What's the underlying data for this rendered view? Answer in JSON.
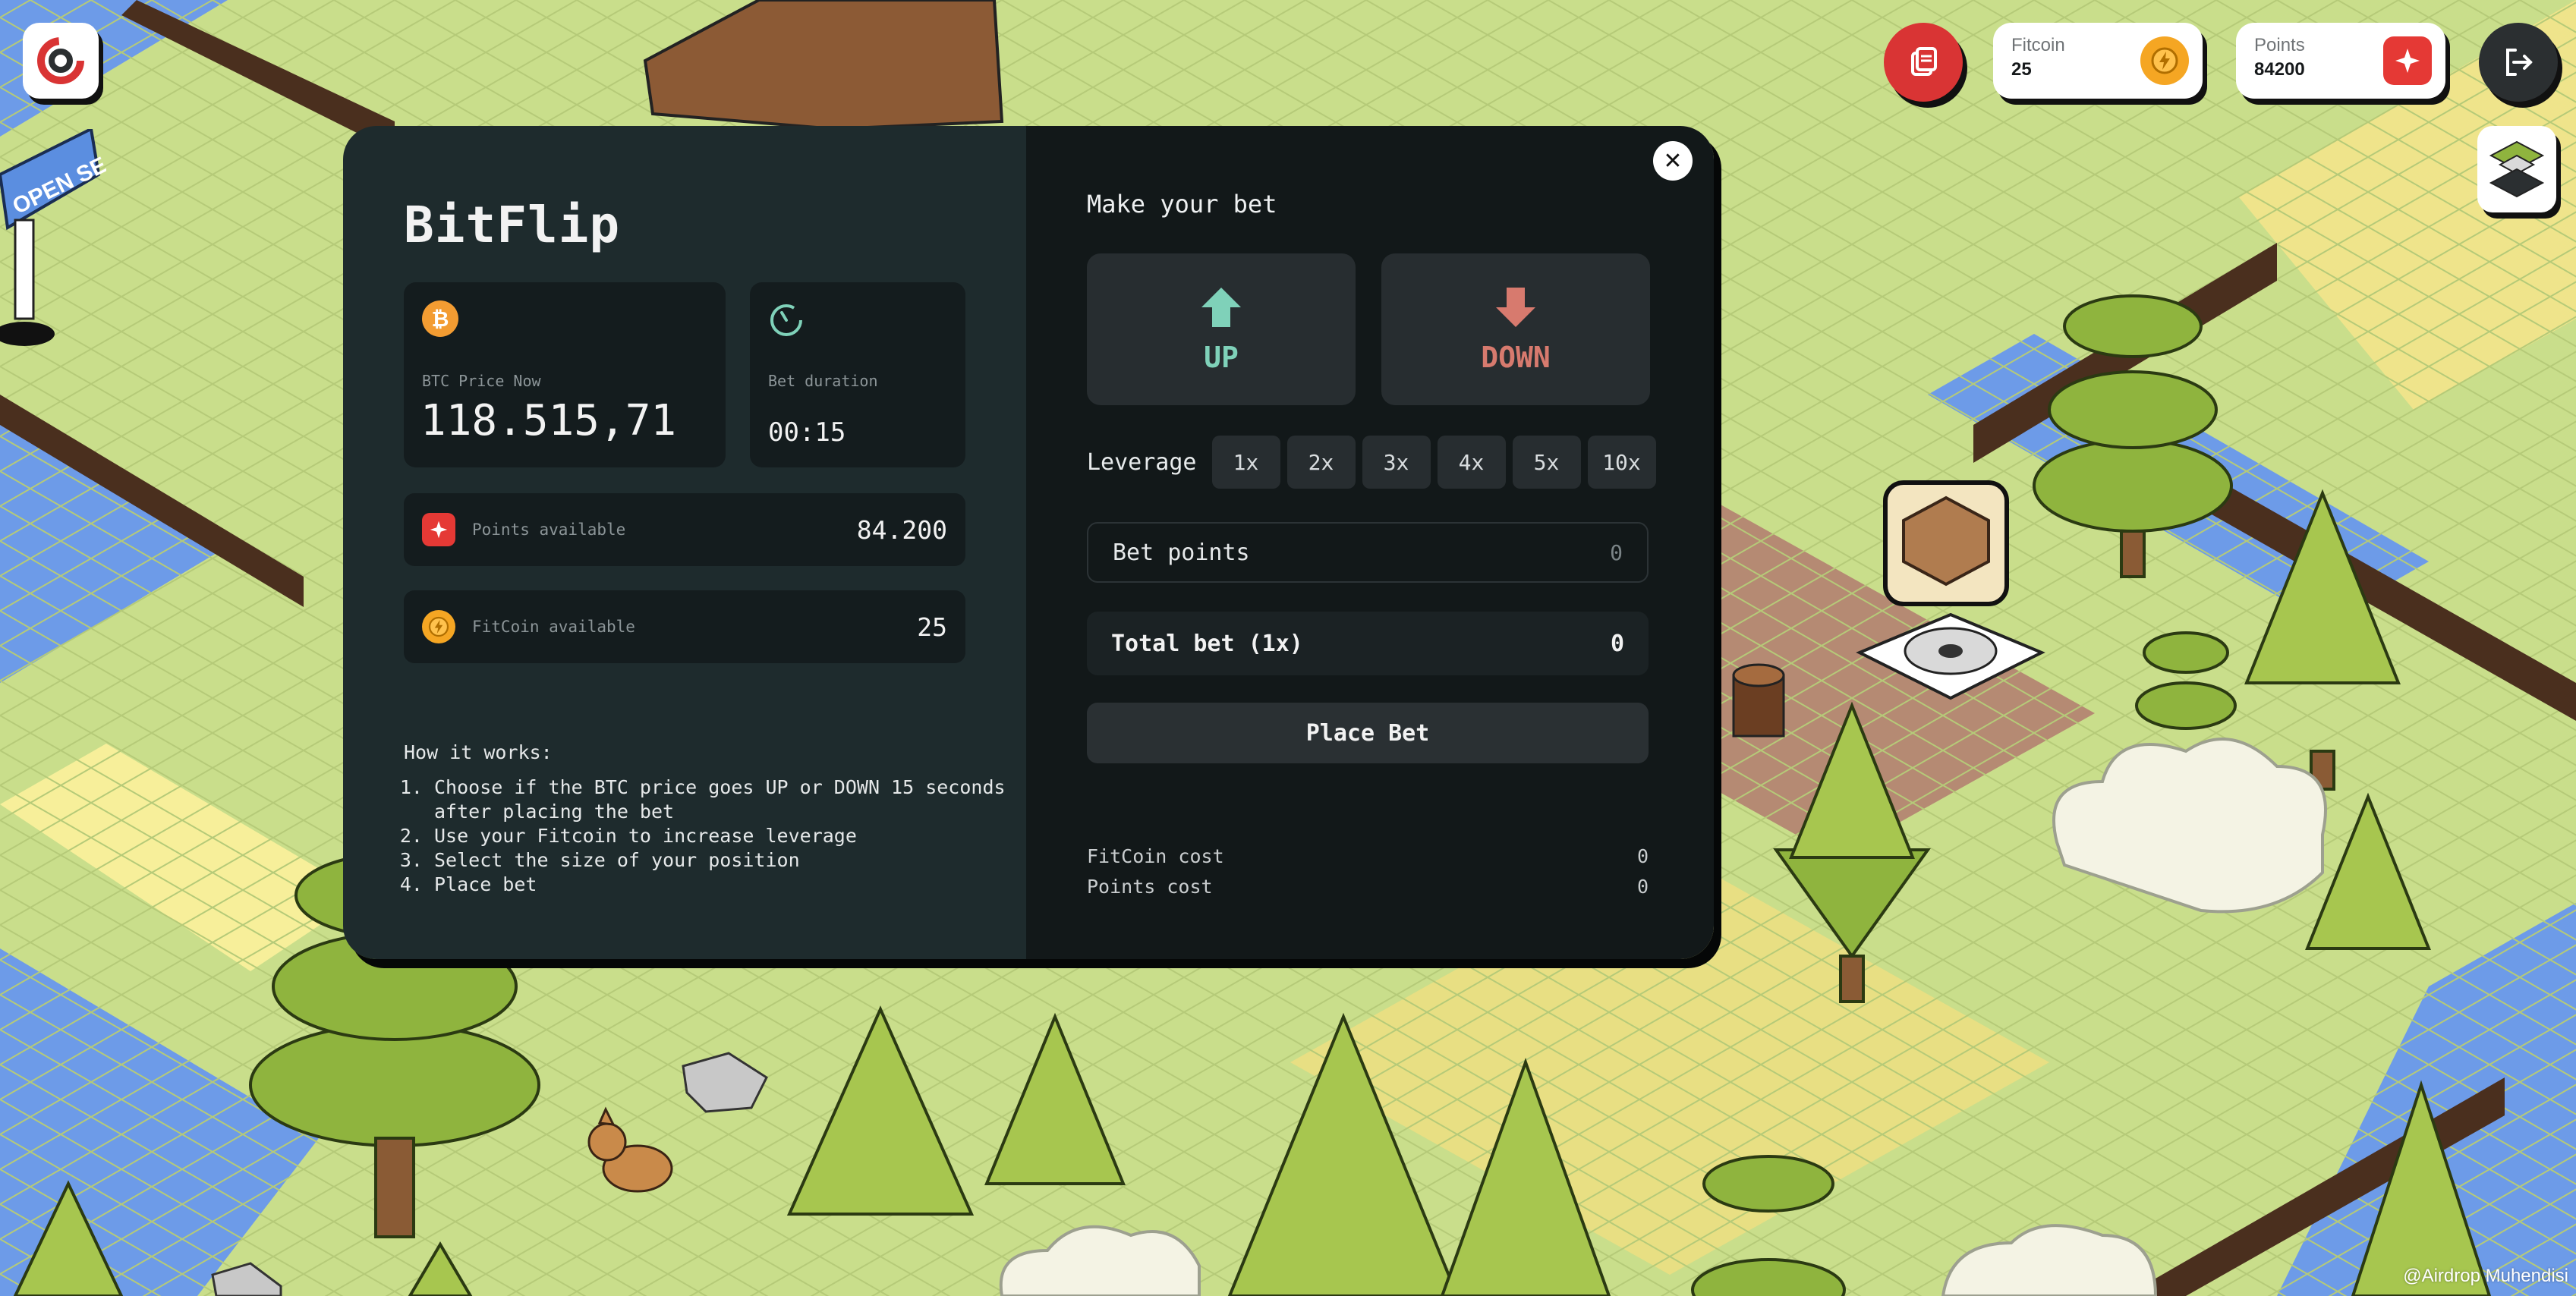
{
  "hud": {
    "fitcoin_label": "Fitcoin",
    "fitcoin_value": "25",
    "points_label": "Points",
    "points_value": "84200"
  },
  "scene": {
    "sign_text": "OPEN SEA",
    "watermark": "@Airdrop Muhendisi"
  },
  "modal": {
    "title": "BitFlip",
    "btc_price_label": "BTC Price Now",
    "btc_price_value": "118.515,71",
    "duration_label": "Bet duration",
    "duration_value": "00:15",
    "points_available_label": "Points available",
    "points_available_value": "84.200",
    "fitcoin_available_label": "FitCoin available",
    "fitcoin_available_value": "25",
    "how_title": "How it works:",
    "how_steps": [
      "Choose if the BTC price goes UP or DOWN 15 seconds after placing the bet",
      "Use your Fitcoin to increase leverage",
      "Select the size of your position",
      "Place bet"
    ],
    "make_bet_title": "Make your bet",
    "up_label": "UP",
    "down_label": "DOWN",
    "leverage_label": "Leverage",
    "leverage_options": [
      "1x",
      "2x",
      "3x",
      "4x",
      "5x",
      "10x"
    ],
    "bet_points_label": "Bet points",
    "bet_points_value": "0",
    "total_bet_label": "Total bet (1x)",
    "total_bet_value": "0",
    "place_bet_label": "Place Bet",
    "fitcoin_cost_label": "FitCoin cost",
    "fitcoin_cost_value": "0",
    "points_cost_label": "Points cost",
    "points_cost_value": "0"
  },
  "colors": {
    "up": "#7fd1b9",
    "down": "#d77a6e",
    "accent_red": "#d93434",
    "coin": "#f5a623"
  }
}
